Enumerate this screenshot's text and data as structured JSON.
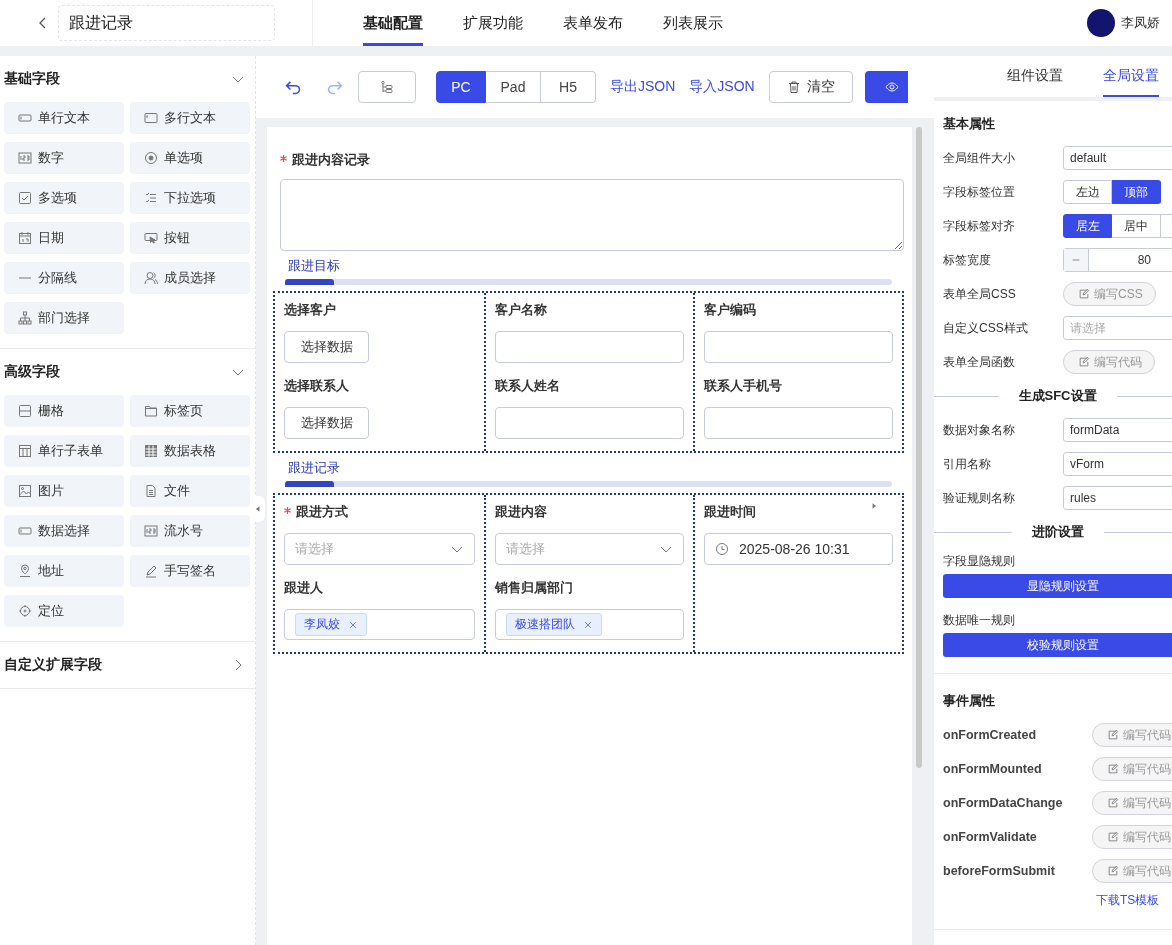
{
  "header": {
    "title": "跟进记录",
    "tabs": [
      {
        "label": "基础配置",
        "selected": true
      },
      {
        "label": "扩展功能",
        "selected": false
      },
      {
        "label": "表单发布",
        "selected": false
      },
      {
        "label": "列表展示",
        "selected": false
      }
    ],
    "user": {
      "name": "李凤娇"
    }
  },
  "palette": [
    {
      "title": "基础字段",
      "expanded": true,
      "items": [
        {
          "label": "单行文本",
          "kind": "text"
        },
        {
          "label": "多行文本",
          "kind": "textarea"
        },
        {
          "label": "数字",
          "kind": "number"
        },
        {
          "label": "单选项",
          "kind": "radio"
        },
        {
          "label": "多选项",
          "kind": "checkbox"
        },
        {
          "label": "下拉选项",
          "kind": "select"
        },
        {
          "label": "日期",
          "kind": "date"
        },
        {
          "label": "按钮",
          "kind": "button"
        },
        {
          "label": "分隔线",
          "kind": "divider"
        },
        {
          "label": "成员选择",
          "kind": "member"
        },
        {
          "label": "部门选择",
          "kind": "dept"
        }
      ]
    },
    {
      "title": "高级字段",
      "expanded": true,
      "items": [
        {
          "label": "栅格",
          "kind": "grid"
        },
        {
          "label": "标签页",
          "kind": "tabs"
        },
        {
          "label": "单行子表单",
          "kind": "subform"
        },
        {
          "label": "数据表格",
          "kind": "table"
        },
        {
          "label": "图片",
          "kind": "image"
        },
        {
          "label": "文件",
          "kind": "file"
        },
        {
          "label": "数据选择",
          "kind": "text"
        },
        {
          "label": "流水号",
          "kind": "number"
        },
        {
          "label": "地址",
          "kind": "address"
        },
        {
          "label": "手写签名",
          "kind": "signature"
        },
        {
          "label": "定位",
          "kind": "location"
        }
      ]
    },
    {
      "title": "自定义扩展字段",
      "expanded": false
    }
  ],
  "toolbar": {
    "devices": [
      {
        "label": "PC",
        "selected": true
      },
      {
        "label": "Pad",
        "selected": false
      },
      {
        "label": "H5",
        "selected": false
      }
    ],
    "links": [
      "导出JSON",
      "导入JSON"
    ],
    "clear": "清空"
  },
  "form": {
    "textarea": {
      "label": "跟进内容记录",
      "required": true
    },
    "groups": [
      {
        "title": "跟进目标",
        "columns": [
          [
            {
              "label": "选择客户",
              "kind": "picker",
              "button": "选择数据"
            },
            {
              "label": "选择联系人",
              "kind": "picker",
              "button": "选择数据"
            }
          ],
          [
            {
              "label": "客户名称",
              "kind": "input"
            },
            {
              "label": "联系人姓名",
              "kind": "input"
            }
          ],
          [
            {
              "label": "客户编码",
              "kind": "input"
            },
            {
              "label": "联系人手机号",
              "kind": "input"
            }
          ]
        ]
      },
      {
        "title": "跟进记录",
        "columns": [
          [
            {
              "label": "跟进方式",
              "kind": "select",
              "required": true,
              "placeholder": "请选择"
            },
            {
              "label": "跟进人",
              "kind": "tags",
              "tags": [
                "李凤姣"
              ]
            }
          ],
          [
            {
              "label": "跟进内容",
              "kind": "select",
              "placeholder": "请选择"
            },
            {
              "label": "销售归属部门",
              "kind": "tags",
              "tags": [
                "极速搭团队"
              ]
            }
          ],
          [
            {
              "label": "跟进时间",
              "kind": "datetime",
              "value": "2025-08-26 10:31"
            }
          ]
        ]
      }
    ]
  },
  "settings": {
    "tabs": [
      {
        "label": "组件设置",
        "selected": false
      },
      {
        "label": "全局设置",
        "selected": true
      }
    ],
    "basic_title": "基本属性",
    "rows": [
      {
        "kind": "input",
        "label": "全局组件大小",
        "value": "default"
      },
      {
        "kind": "segment",
        "label": "字段标签位置",
        "options": [
          {
            "label": "左边",
            "selected": false
          },
          {
            "label": "顶部",
            "selected": true
          }
        ]
      },
      {
        "kind": "segment",
        "label": "字段标签对齐",
        "options": [
          {
            "label": "居左",
            "selected": true
          },
          {
            "label": "居中",
            "selected": false
          },
          {
            "selected": false
          }
        ]
      },
      {
        "kind": "number",
        "label": "标签宽度",
        "value": "80"
      },
      {
        "kind": "code",
        "label": "表单全局CSS",
        "button": "编写CSS"
      },
      {
        "kind": "input",
        "label": "自定义CSS样式",
        "placeholder": "请选择"
      },
      {
        "kind": "code",
        "label": "表单全局函数",
        "button": "编写代码"
      },
      {
        "kind": "heading",
        "label": "生成SFC设置"
      },
      {
        "kind": "input",
        "label": "数据对象名称",
        "value": "formData"
      },
      {
        "kind": "input",
        "label": "引用名称",
        "value": "vForm"
      },
      {
        "kind": "input",
        "label": "验证规则名称",
        "value": "rules"
      },
      {
        "kind": "heading",
        "label": "进阶设置"
      },
      {
        "kind": "action",
        "label": "字段显隐规则",
        "button": "显隐规则设置"
      },
      {
        "kind": "action",
        "label": "数据唯一规则",
        "button": "校验规则设置"
      }
    ],
    "events_title": "事件属性",
    "events": [
      {
        "name": "onFormCreated",
        "button": "编写代码"
      },
      {
        "name": "onFormMounted",
        "button": "编写代码"
      },
      {
        "name": "onFormDataChange",
        "button": "编写代码"
      },
      {
        "name": "onFormValidate",
        "button": "编写代码"
      },
      {
        "name": "beforeFormSubmit",
        "button": "编写代码"
      }
    ],
    "download": "下载TS模板"
  }
}
